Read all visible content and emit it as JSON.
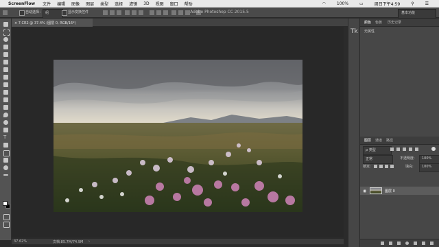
{
  "menubar": {
    "app_name": "ScreenFlow",
    "items": [
      "文件",
      "编辑",
      "图像",
      "图层",
      "类型",
      "选择",
      "滤镜",
      "3D",
      "视图",
      "窗口",
      "帮助"
    ],
    "status_right": {
      "battery": "100%",
      "clock": "周日下午4:59"
    }
  },
  "options_bar": {
    "window_title": "Adobe Photoshop CC 2015.5",
    "auto_select_label": "自动选择：",
    "auto_select_value": "组",
    "show_transform_label": "显示变换控件",
    "workspace_label": "基本功能"
  },
  "document": {
    "tab_title": "7.CR2 @ 37.4% (图层 0, RGB/16*)",
    "zoom": "37.62%",
    "doc_size": "文档:85.7M/74.9M"
  },
  "right_panels": {
    "top_tabs": [
      "颜色",
      "色板",
      "历史记录"
    ],
    "top_message": "无属性",
    "layer_tabs": [
      "图层",
      "通道",
      "路径"
    ],
    "filter_label": "ρ 类型",
    "blend_mode": "正常",
    "opacity_label": "不透明度:",
    "opacity_value": "100%",
    "lock_label": "锁定:",
    "fill_label": "填充:",
    "fill_value": "100%",
    "layer_name": "图层 0"
  },
  "colors": {
    "foreground": "#ffffff",
    "background": "#000000"
  }
}
